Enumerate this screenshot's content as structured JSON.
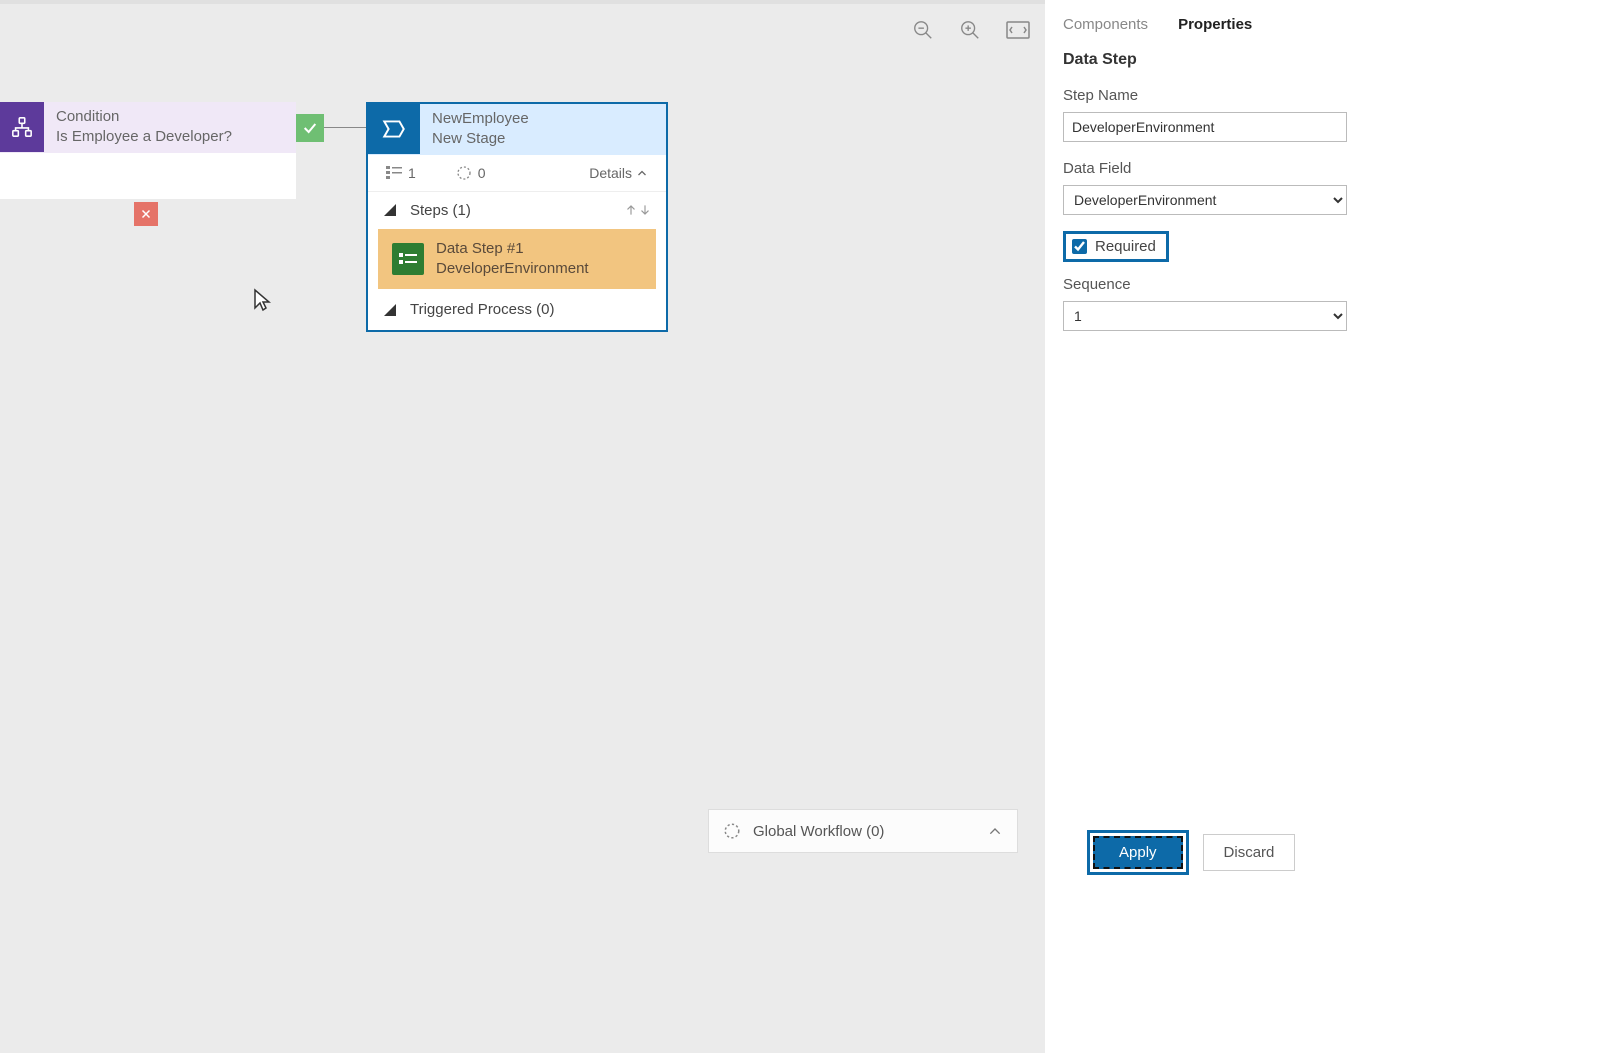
{
  "condition": {
    "title": "Condition",
    "subtitle": "Is Employee a Developer?"
  },
  "stage": {
    "title": "NewEmployee",
    "subtitle": "New Stage",
    "list_count": "1",
    "circle_count": "0",
    "details_label": "Details",
    "steps_header": "Steps (1)",
    "data_step_title": "Data Step #1",
    "data_step_subtitle": "DeveloperEnvironment",
    "triggered_process": "Triggered Process (0)"
  },
  "global_workflow": {
    "label": "Global Workflow (0)"
  },
  "panel": {
    "tabs": {
      "components": "Components",
      "properties": "Properties"
    },
    "title": "Data Step",
    "step_name_label": "Step Name",
    "step_name_value": "DeveloperEnvironment",
    "data_field_label": "Data Field",
    "data_field_value": "DeveloperEnvironment",
    "required_label": "Required",
    "sequence_label": "Sequence",
    "sequence_value": "1",
    "apply_label": "Apply",
    "discard_label": "Discard"
  }
}
